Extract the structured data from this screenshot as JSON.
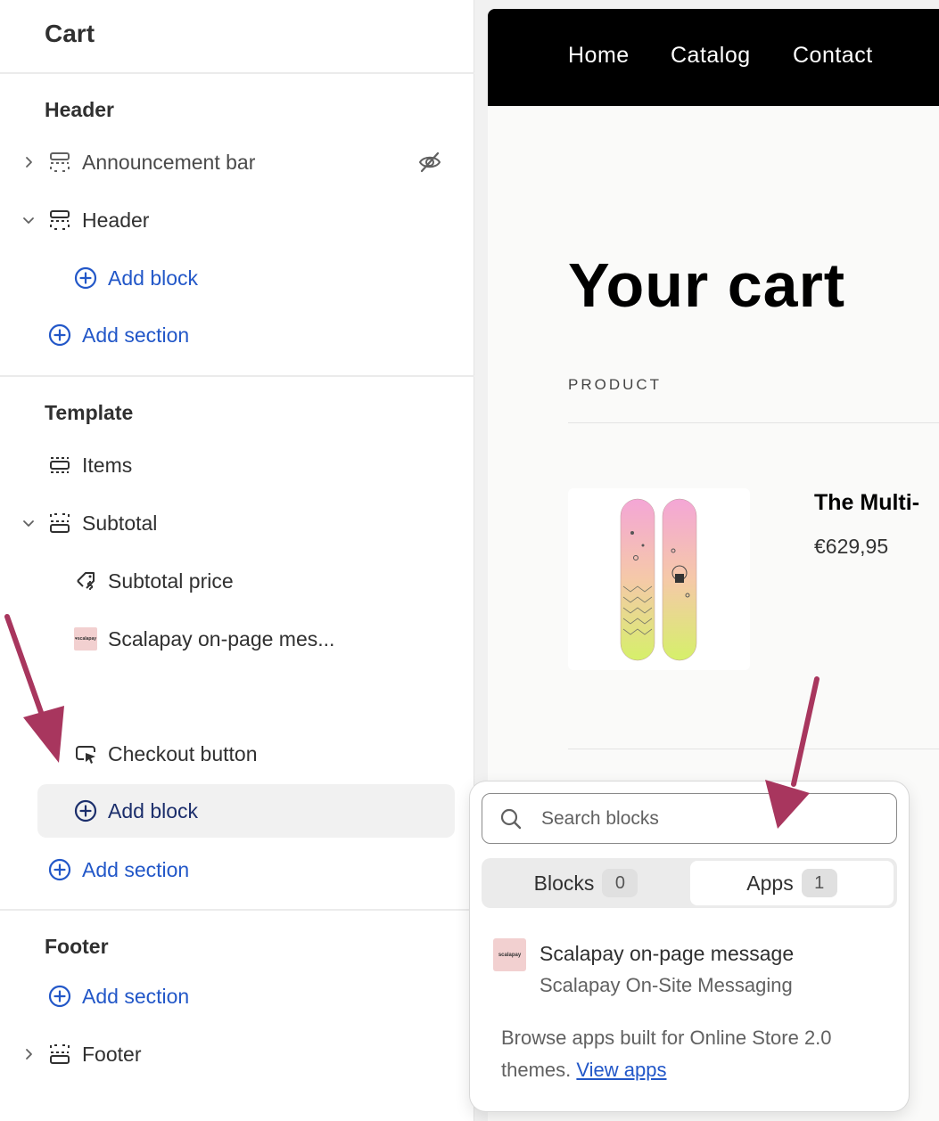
{
  "sidebar": {
    "title": "Cart",
    "header_group": {
      "title": "Header",
      "announcement_bar": "Announcement bar",
      "header": "Header",
      "add_block": "Add block",
      "add_section": "Add section"
    },
    "template_group": {
      "title": "Template",
      "items": "Items",
      "subtotal": "Subtotal",
      "subtotal_price": "Subtotal price",
      "scalapay": "Scalapay on-page mes...",
      "checkout_button": "Checkout button",
      "add_block": "Add block",
      "add_section": "Add section"
    },
    "footer_group": {
      "title": "Footer",
      "add_section": "Add section",
      "footer": "Footer"
    }
  },
  "preview": {
    "nav": [
      "Home",
      "Catalog",
      "Contact"
    ],
    "heading": "Your cart",
    "product_column": "PRODUCT",
    "product_name": "The Multi-",
    "product_price": "€629,95"
  },
  "popover": {
    "search_placeholder": "Search blocks",
    "tabs": [
      {
        "label": "Blocks",
        "count": "0",
        "active": false
      },
      {
        "label": "Apps",
        "count": "1",
        "active": true
      }
    ],
    "app": {
      "logo_text": "scalapay",
      "title": "Scalapay on-page message",
      "subtitle": "Scalapay On-Site Messaging"
    },
    "browse_text": "Browse apps built for Online Store 2.0 themes.",
    "browse_link": "View apps"
  },
  "colors": {
    "link": "#2257c8",
    "arrow": "#a8365e",
    "nav_bg": "#000000"
  }
}
